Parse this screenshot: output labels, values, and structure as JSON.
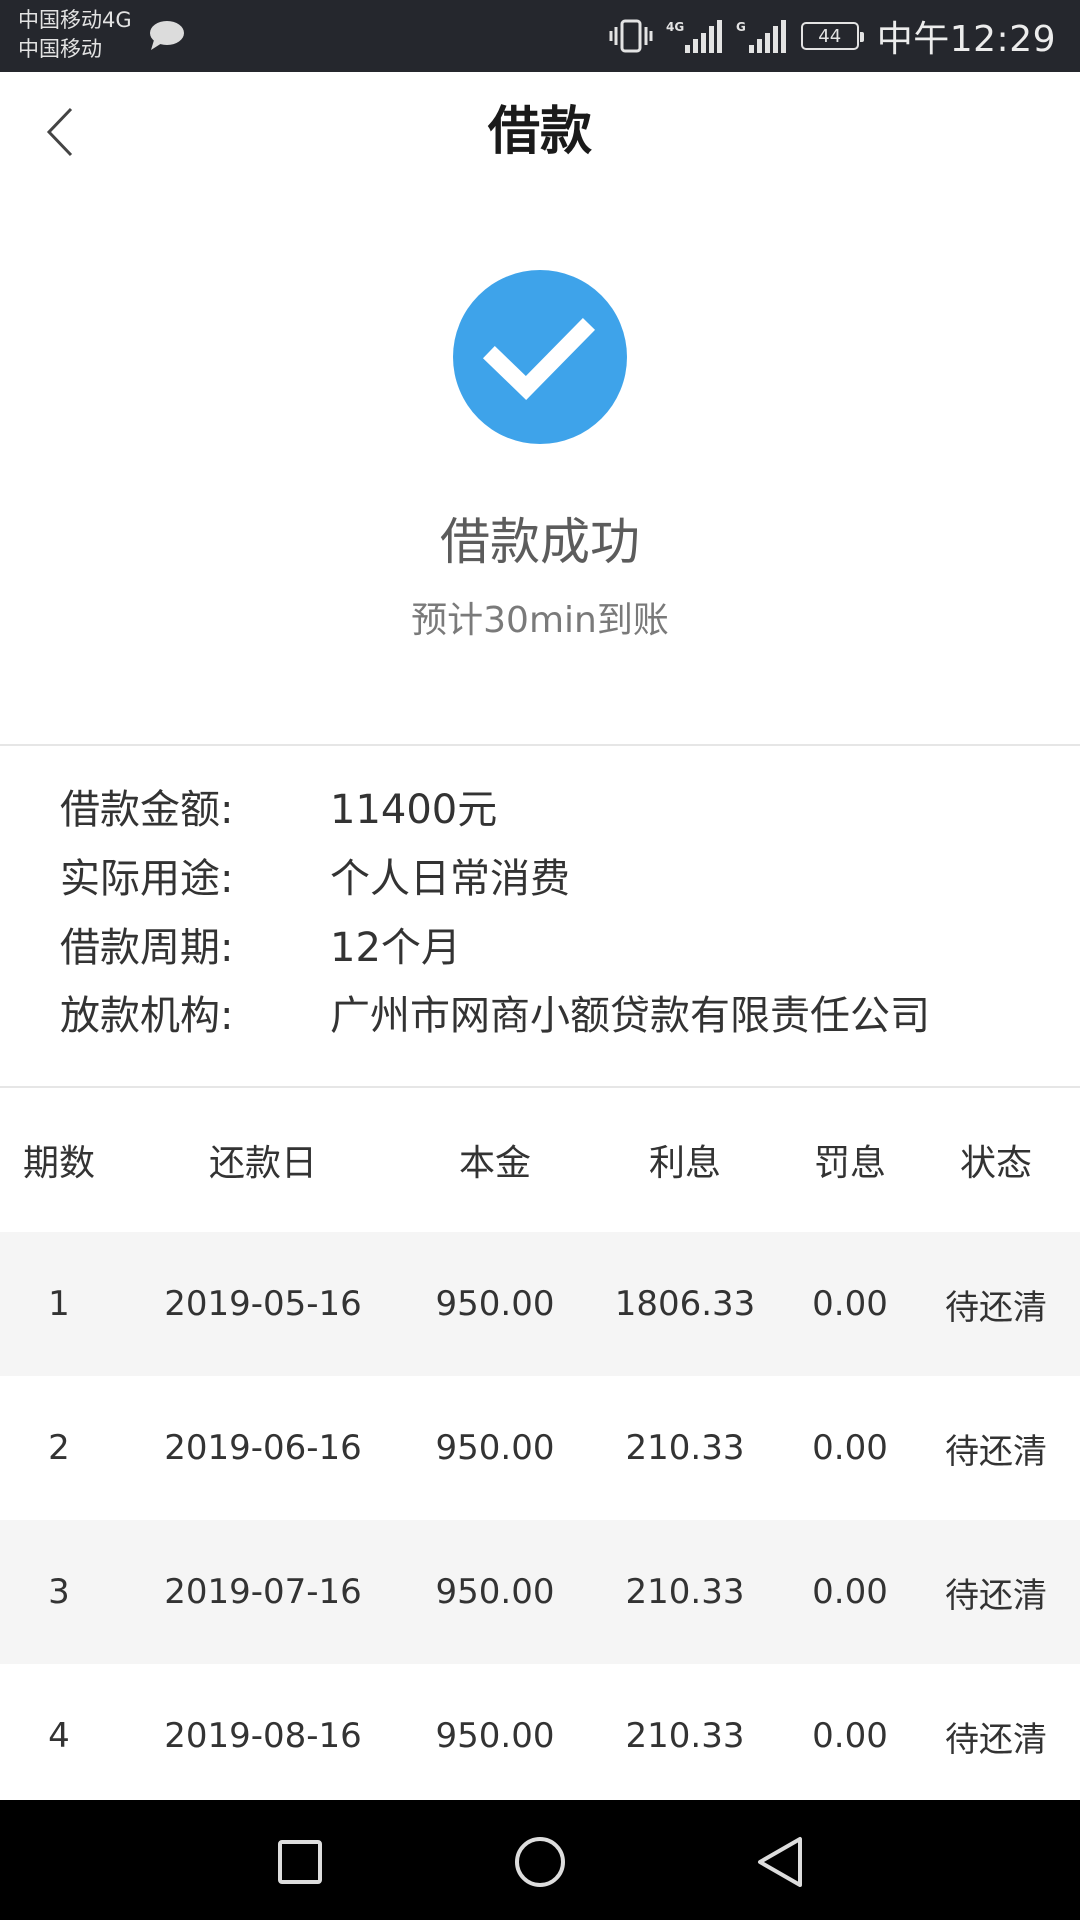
{
  "status_bar": {
    "carrier_1": "中国移动4G",
    "carrier_2": "中国移动",
    "battery_level": "44",
    "time": "中午12:29",
    "icons": [
      "chat-bubble-icon",
      "vibrate-icon",
      "signal-4g-icon",
      "signal-g-icon",
      "battery-icon"
    ]
  },
  "header": {
    "title": "借款",
    "back_icon": "chevron-left-icon"
  },
  "success": {
    "icon": "check-circle-icon",
    "title": "借款成功",
    "subtitle": "预计30min到账",
    "accent_color": "#3ea3ea"
  },
  "loan_info": [
    {
      "label": "借款金额:",
      "value": "11400元"
    },
    {
      "label": "实际用途:",
      "value": "个人日常消费"
    },
    {
      "label": "借款周期:",
      "value": "12个月"
    },
    {
      "label": "放款机构:",
      "value": "广州市网商小额贷款有限责任公司"
    }
  ],
  "schedule": {
    "headers": [
      "期数",
      "还款日",
      "本金",
      "利息",
      "罚息",
      "状态"
    ],
    "rows": [
      [
        "1",
        "2019-05-16",
        "950.00",
        "1806.33",
        "0.00",
        "待还清"
      ],
      [
        "2",
        "2019-06-16",
        "950.00",
        "210.33",
        "0.00",
        "待还清"
      ],
      [
        "3",
        "2019-07-16",
        "950.00",
        "210.33",
        "0.00",
        "待还清"
      ],
      [
        "4",
        "2019-08-16",
        "950.00",
        "210.33",
        "0.00",
        "待还清"
      ]
    ]
  },
  "nav_bar": {
    "icons": [
      "recent-apps-icon",
      "home-icon",
      "back-triangle-icon"
    ]
  }
}
